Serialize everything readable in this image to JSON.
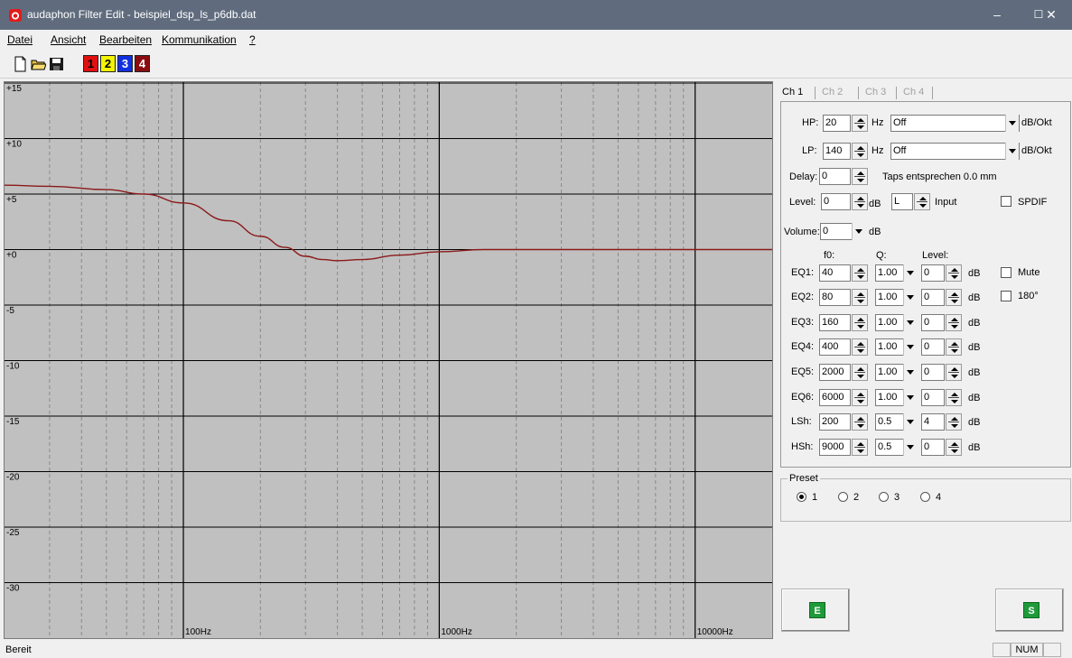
{
  "window": {
    "title": "audaphon Filter Edit - beispiel_dsp_ls_p6db.dat",
    "minimize_glyph": "–",
    "maximize_glyph": "☐",
    "close_glyph": "✕"
  },
  "menu": [
    {
      "label": "Datei"
    },
    {
      "label": "Ansicht"
    },
    {
      "label": "Bearbeiten"
    },
    {
      "label": "Kommunikation"
    },
    {
      "label": "?"
    }
  ],
  "toolbar": {
    "icons": [
      "new-file-icon",
      "open-folder-icon",
      "save-disk-icon"
    ],
    "channel_buttons": [
      {
        "label": "1",
        "color": "#e01010",
        "text_color": "#000000"
      },
      {
        "label": "2",
        "color": "#f4f400",
        "text_color": "#000000"
      },
      {
        "label": "3",
        "color": "#1030e0",
        "text_color": "#ffffff"
      },
      {
        "label": "4",
        "color": "#8a0c10",
        "text_color": "#ffffff"
      }
    ]
  },
  "chart_data": {
    "type": "line",
    "x_scale": "log",
    "xlim": [
      20,
      20000
    ],
    "ylim": [
      -35,
      15
    ],
    "y_ticks": [
      "+15",
      "+10",
      "+5",
      "+0",
      "-5",
      "-10",
      "-15",
      "-20",
      "-25",
      "-30"
    ],
    "y_tick_values": [
      15,
      10,
      5,
      0,
      -5,
      -10,
      -15,
      -20,
      -25,
      -30
    ],
    "x_tick_labels": [
      "100Hz",
      "1000Hz",
      "10000Hz"
    ],
    "x_tick_values": [
      100,
      1000,
      10000
    ],
    "grid": true,
    "background": "#c0c0c0",
    "series": [
      {
        "color": "#8b1a1a",
        "x": [
          20,
          30,
          50,
          70,
          100,
          150,
          200,
          250,
          300,
          350,
          400,
          500,
          700,
          1000,
          1500,
          2000,
          3000,
          5000,
          20000
        ],
        "y": [
          5.8,
          5.7,
          5.4,
          5.0,
          4.2,
          2.6,
          1.2,
          0.2,
          -0.6,
          -0.9,
          -1.0,
          -0.9,
          -0.5,
          -0.2,
          0.0,
          0.0,
          0.0,
          0.0,
          0.0
        ]
      }
    ]
  },
  "tabs": [
    {
      "label": "Ch 1",
      "active": true
    },
    {
      "label": "Ch 2",
      "active": false
    },
    {
      "label": "Ch 3",
      "active": false
    },
    {
      "label": "Ch 4",
      "active": false
    }
  ],
  "channel": {
    "hp": {
      "label": "HP:",
      "value": "20",
      "unit": "Hz",
      "slope": "Off",
      "slope_unit": "dB/Okt"
    },
    "lp": {
      "label": "LP:",
      "value": "140",
      "unit": "Hz",
      "slope": "Off",
      "slope_unit": "dB/Okt"
    },
    "delay": {
      "label": "Delay:",
      "value": "0",
      "note": "Taps entsprechen 0.0 mm"
    },
    "level": {
      "label": "Level:",
      "value": "0",
      "unit": "dB",
      "input_value": "L",
      "input_label": "Input"
    },
    "spdif": {
      "label": "SPDIF",
      "checked": false
    },
    "volume": {
      "label": "Volume:",
      "value": "0",
      "unit": "dB"
    },
    "eq_headers": {
      "f0": "f0:",
      "q": "Q:",
      "level": "Level:"
    },
    "eq_rows": [
      {
        "label": "EQ1:",
        "f0": "40",
        "q": "1.00",
        "level": "0",
        "unit": "dB"
      },
      {
        "label": "EQ2:",
        "f0": "80",
        "q": "1.00",
        "level": "0",
        "unit": "dB"
      },
      {
        "label": "EQ3:",
        "f0": "160",
        "q": "1.00",
        "level": "0",
        "unit": "dB"
      },
      {
        "label": "EQ4:",
        "f0": "400",
        "q": "1.00",
        "level": "0",
        "unit": "dB"
      },
      {
        "label": "EQ5:",
        "f0": "2000",
        "q": "1.00",
        "level": "0",
        "unit": "dB"
      },
      {
        "label": "EQ6:",
        "f0": "6000",
        "q": "1.00",
        "level": "0",
        "unit": "dB"
      },
      {
        "label": "LSh:",
        "f0": "200",
        "q": "0.5",
        "level": "4",
        "unit": "dB"
      },
      {
        "label": "HSh:",
        "f0": "9000",
        "q": "0.5",
        "level": "0",
        "unit": "dB"
      }
    ],
    "mute": {
      "label": "Mute",
      "checked": false
    },
    "phase": {
      "label": "180°",
      "checked": false
    }
  },
  "preset": {
    "legend": "Preset",
    "options": [
      "1",
      "2",
      "3",
      "4"
    ],
    "selected": 0
  },
  "buttons": {
    "e_label": "E",
    "s_label": "S"
  },
  "status": {
    "text": "Bereit",
    "num": "NUM"
  }
}
